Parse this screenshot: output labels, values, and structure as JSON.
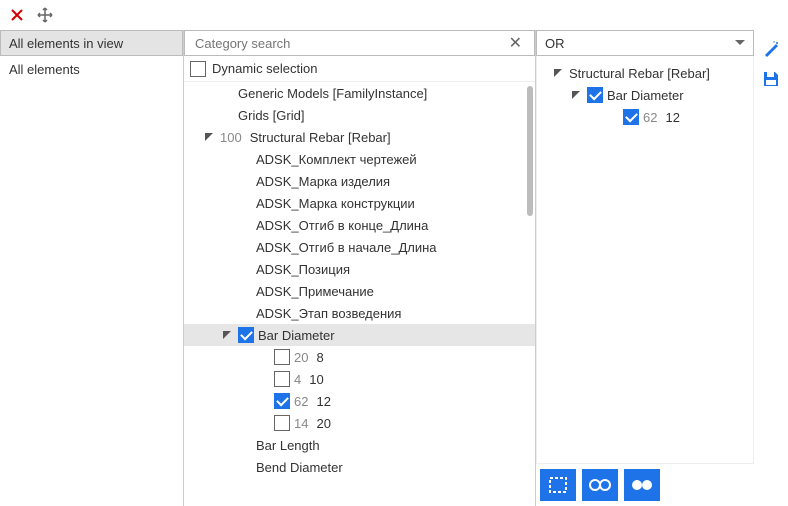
{
  "toolbar": {},
  "col1": {
    "header": "All elements in view",
    "items": [
      "All elements"
    ]
  },
  "col2": {
    "search_placeholder": "Category search",
    "dynamic_label": "Dynamic selection",
    "tree": [
      {
        "indent": 1,
        "label": "Generic Models [FamilyInstance]"
      },
      {
        "indent": 1,
        "label": "Grids [Grid]"
      },
      {
        "indent": 0,
        "expander": "open",
        "count": "100",
        "label": "Structural Rebar [Rebar]"
      },
      {
        "indent": 2,
        "label": "ADSK_Комплект чертежей"
      },
      {
        "indent": 2,
        "label": "ADSK_Марка изделия"
      },
      {
        "indent": 2,
        "label": "ADSK_Марка конструкции"
      },
      {
        "indent": 2,
        "label": "ADSK_Отгиб в конце_Длина"
      },
      {
        "indent": 2,
        "label": "ADSK_Отгиб в начале_Длина"
      },
      {
        "indent": 2,
        "label": "ADSK_Позиция"
      },
      {
        "indent": 2,
        "label": "ADSK_Примечание"
      },
      {
        "indent": 2,
        "label": "ADSK_Этап возведения"
      },
      {
        "indent": 1,
        "expander": "open",
        "checkbox": true,
        "checked": true,
        "label": "Bar Diameter",
        "highlight": true
      },
      {
        "indent": 3,
        "checkbox": true,
        "checked": false,
        "count": "20",
        "label": "8"
      },
      {
        "indent": 3,
        "checkbox": true,
        "checked": false,
        "count": "4",
        "label": "10"
      },
      {
        "indent": 3,
        "checkbox": true,
        "checked": true,
        "count": "62",
        "label": "12"
      },
      {
        "indent": 3,
        "checkbox": true,
        "checked": false,
        "count": "14",
        "label": "20"
      },
      {
        "indent": 2,
        "label": "Bar Length"
      },
      {
        "indent": 2,
        "label": "Bend Diameter"
      }
    ]
  },
  "col3": {
    "dropdown_value": "OR",
    "tree": [
      {
        "indent": 0,
        "expander": "open",
        "label": "Structural Rebar [Rebar]"
      },
      {
        "indent": 1,
        "expander": "open",
        "checkbox": true,
        "checked": true,
        "label": "Bar Diameter"
      },
      {
        "indent": 3,
        "checkbox": true,
        "checked": true,
        "count": "62",
        "label": "12"
      }
    ]
  }
}
